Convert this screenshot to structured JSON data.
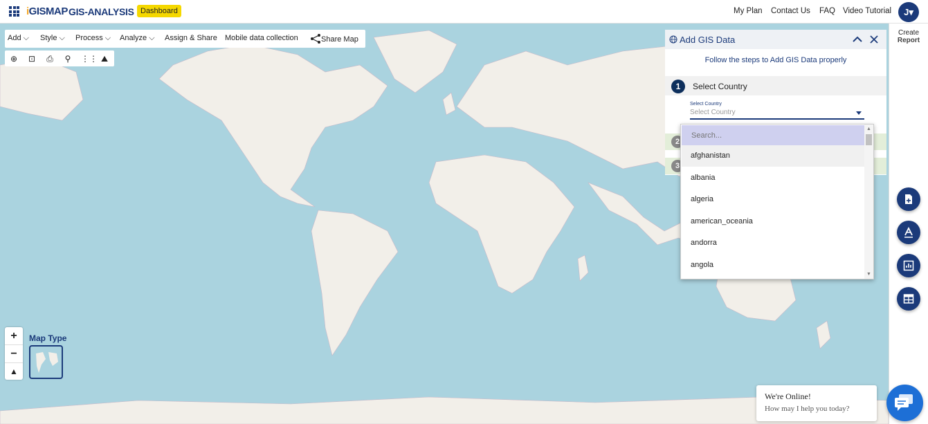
{
  "header": {
    "logo": "GISMAP",
    "app_title": "GIS-ANALYSIS",
    "dashboard_badge": "Dashboard",
    "links": [
      "My Plan",
      "Contact Us",
      "FAQ",
      "Video Tutorial"
    ],
    "avatar_letter": "J"
  },
  "toolbar": {
    "menu": [
      "Add",
      "Style",
      "Process",
      "Analyze",
      "Assign & Share",
      "Mobile data collection",
      "Share Map"
    ]
  },
  "tool_icons": [
    "locate-icon",
    "focus-icon",
    "print-icon",
    "search-icon",
    "measure-icon",
    "terrain-icon"
  ],
  "map": {
    "zoom_in": "+",
    "zoom_out": "−",
    "map_type_label": "Map Type"
  },
  "right_rail": {
    "create_report_l1": "Create",
    "create_report_l2": "Report",
    "fab_icons": [
      "add-document-icon",
      "text-style-icon",
      "chart-icon",
      "table-icon"
    ]
  },
  "panel": {
    "title": "Add GIS Data",
    "subtitle": "Follow the steps to Add GIS Data properly",
    "step1_number": "1",
    "step1_label": "Select Country",
    "select_small_label": "Select Country",
    "select_placeholder": "Select Country",
    "step2_number": "2",
    "step3_number": "3"
  },
  "dropdown": {
    "search_placeholder": "Search...",
    "options": [
      "afghanistan",
      "albania",
      "algeria",
      "american_oceania",
      "andorra",
      "angola"
    ]
  },
  "chat": {
    "line1": "We're Online!",
    "line2": "How may I help you today?"
  },
  "colors": {
    "brand": "#1b3a7a",
    "badge": "#f5d800",
    "water": "#aad3df",
    "land": "#f2efe9"
  }
}
